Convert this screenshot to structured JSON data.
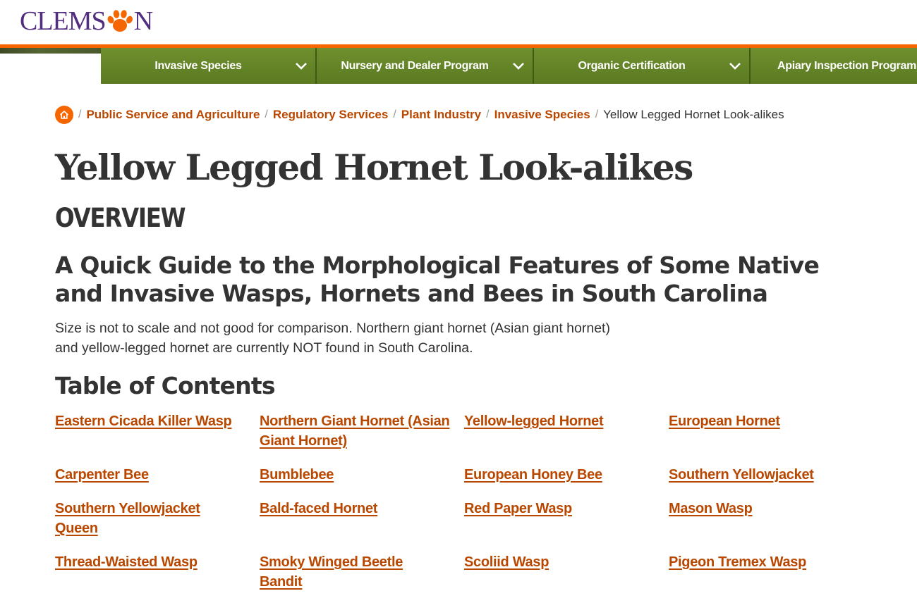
{
  "header": {
    "logo_text_left": "CLEMS",
    "logo_text_right": "N",
    "brand_purple": "#522d80",
    "brand_orange": "#f56600"
  },
  "nav": {
    "items": [
      {
        "label": "Invasive Species",
        "icon": "chevron-down-icon"
      },
      {
        "label": "Nursery and Dealer Program",
        "icon": "chevron-down-icon"
      },
      {
        "label": "Organic Certification",
        "icon": "chevron-down-icon"
      },
      {
        "label": "Apiary Inspection Program",
        "icon": "chevron-down-icon"
      }
    ],
    "color": "#5b7a22"
  },
  "breadcrumb": {
    "home_icon": "home-icon",
    "links": [
      "Public Service and Agriculture",
      "Regulatory Services",
      "Plant Industry",
      "Invasive Species"
    ],
    "current": "Yellow Legged Hornet Look-alikes",
    "link_color": "#b94700"
  },
  "main": {
    "title": "Yellow Legged Hornet Look-alikes",
    "overview": "OVERVIEW",
    "subhead": "A Quick Guide to the Morphological Features of Some Native and Invasive Wasps, Hornets and Bees in South Carolina",
    "intro": "Size is not to scale and not good for comparison. Northern giant hornet (Asian giant hornet) and yellow-legged hornet are currently NOT found in South Carolina.",
    "toc_title": "Table of Contents",
    "toc": [
      "Eastern Cicada Killer Wasp",
      "Northern Giant Hornet (Asian Giant Hornet)",
      "Yellow-legged Hornet",
      "European Hornet",
      "Carpenter Bee",
      "Bumblebee",
      "European Honey Bee",
      "Southern Yellowjacket",
      "Southern Yellowjacket Queen",
      "Bald-faced Hornet",
      "Red Paper Wasp",
      "Mason Wasp",
      "Thread-Waisted Wasp",
      "Smoky Winged Beetle Bandit",
      "Scoliid Wasp",
      "Pigeon Tremex Wasp"
    ]
  }
}
